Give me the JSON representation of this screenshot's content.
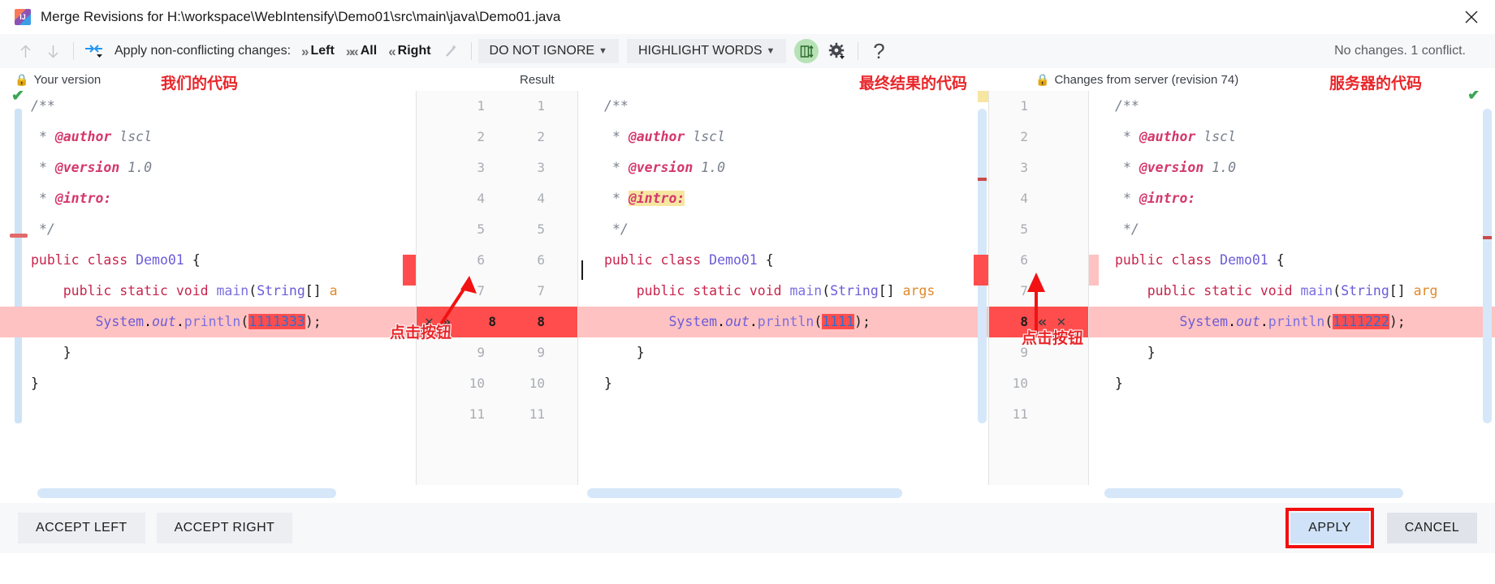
{
  "window": {
    "title": "Merge Revisions for H:\\workspace\\WebIntensify\\Demo01\\src\\main\\java\\Demo01.java",
    "app_icon": "intellij-idea-icon",
    "close_label": "✕"
  },
  "toolbar": {
    "prev_icon": "arrow-up-icon",
    "next_icon": "arrow-down-icon",
    "apply_all_icon": "apply-non-conflicting-icon",
    "apply_label": "Apply non-conflicting changes:",
    "left_label": "Left",
    "all_label": "All",
    "right_label": "Right",
    "magic_icon": "magic-wand-icon",
    "ignore_policy": "DO NOT IGNORE",
    "highlight_policy": "HIGHLIGHT WORDS",
    "collapse_icon": "collapse-unchanged-icon",
    "settings_icon": "gear-icon",
    "help_icon": "help-question-icon",
    "status": "No changes. 1 conflict."
  },
  "panes": {
    "left_title": "Your version",
    "left_annotation": "我们的代码",
    "middle_title": "Result",
    "middle_annotation": "最终结果的代码",
    "right_title": "Changes from server (revision 74)",
    "right_annotation": "服务器的代码",
    "lock_icon": "lock-icon"
  },
  "annotations": {
    "left_button_note": "点击按钮",
    "right_button_note": "点击按钮"
  },
  "left_code": [
    {
      "n": 1,
      "html": "<span class='cmt'>/**</span>"
    },
    {
      "n": 2,
      "html": " <span class='cmt'>* </span><span class='tag'>@author</span><span class='cmt'> lscl</span>"
    },
    {
      "n": 3,
      "html": " <span class='cmt'>* </span><span class='tag'>@version</span><span class='cmt'> 1.0</span>"
    },
    {
      "n": 4,
      "html": " <span class='cmt'>* </span><span class='tag'>@intro:</span>"
    },
    {
      "n": 5,
      "html": " <span class='cmt'>*/</span>"
    },
    {
      "n": 6,
      "html": "<span class='kw'>public class </span><span class='typ'>Demo01</span> <span class='pun'>{</span>"
    },
    {
      "n": 7,
      "html": "    <span class='kw'>public static void </span><span class='idn'>main</span><span class='pun'>(</span><span class='typ'>String</span><span class='pun'>[] </span><span class='var'>a</span>"
    },
    {
      "n": 8,
      "html": "        <span class='typ'>System</span>.<span class='fld'>out</span>.<span class='idn'>println</span><span class='pun'>(</span><span class='hl-red'>1111333</span><span class='pun'>);</span>",
      "conflict": true
    },
    {
      "n": 9,
      "html": "    <span class='pun'>}</span>"
    },
    {
      "n": 10,
      "html": "<span class='pun'>}</span>"
    },
    {
      "n": 11,
      "html": ""
    }
  ],
  "middle_code": [
    {
      "n": 1,
      "html": "<span class='cmt'>/**</span>"
    },
    {
      "n": 2,
      "html": " <span class='cmt'>* </span><span class='tag'>@author</span><span class='cmt'> lscl</span>"
    },
    {
      "n": 3,
      "html": " <span class='cmt'>* </span><span class='tag'>@version</span><span class='cmt'> 1.0</span>"
    },
    {
      "n": 4,
      "html": " <span class='cmt'>* </span><span class='hl-yellow'><span class='tag'>@intro:</span></span>"
    },
    {
      "n": 5,
      "html": " <span class='cmt'>*/</span>"
    },
    {
      "n": 6,
      "html": "<span class='kw'>public class </span><span class='typ'>Demo01</span> <span class='pun'>{</span>"
    },
    {
      "n": 7,
      "html": "    <span class='kw'>public static void </span><span class='idn'>main</span><span class='pun'>(</span><span class='typ'>String</span><span class='pun'>[] </span><span class='var'>args</span>"
    },
    {
      "n": 8,
      "html": "        <span class='typ'>System</span>.<span class='fld'>out</span>.<span class='idn'>println</span><span class='pun'>(</span><span class='hl-red'>1111</span><span class='pun'>);</span>",
      "conflict": true
    },
    {
      "n": 9,
      "html": "    <span class='pun'>}</span>"
    },
    {
      "n": 10,
      "html": "<span class='pun'>}</span>"
    },
    {
      "n": 11,
      "html": ""
    }
  ],
  "right_code": [
    {
      "n": 1,
      "html": "<span class='cmt'>/**</span>"
    },
    {
      "n": 2,
      "html": " <span class='cmt'>* </span><span class='tag'>@author</span><span class='cmt'> lscl</span>"
    },
    {
      "n": 3,
      "html": " <span class='cmt'>* </span><span class='tag'>@version</span><span class='cmt'> 1.0</span>"
    },
    {
      "n": 4,
      "html": " <span class='cmt'>* </span><span class='tag'>@intro:</span>"
    },
    {
      "n": 5,
      "html": " <span class='cmt'>*/</span>"
    },
    {
      "n": 6,
      "html": "<span class='kw'>public class </span><span class='typ'>Demo01</span> <span class='pun'>{</span>"
    },
    {
      "n": 7,
      "html": "    <span class='kw'>public static void </span><span class='idn'>main</span><span class='pun'>(</span><span class='typ'>String</span><span class='pun'>[] </span><span class='var'>arg</span>"
    },
    {
      "n": 8,
      "html": "        <span class='typ'>System</span>.<span class='fld'>out</span>.<span class='idn'>println</span><span class='pun'>(</span><span class='hl-red'>1111222</span><span class='pun'>);</span>",
      "conflict": true
    },
    {
      "n": 9,
      "html": "    <span class='pun'>}</span>"
    },
    {
      "n": 10,
      "html": "<span class='pun'>}</span>"
    },
    {
      "n": 11,
      "html": ""
    }
  ],
  "gutter_left": {
    "numbers_left": [
      "1",
      "2",
      "3",
      "4",
      "5",
      "6",
      "7",
      "8",
      "9",
      "10",
      "11"
    ],
    "numbers_right": [
      "1",
      "2",
      "3",
      "4",
      "5",
      "6",
      "7",
      "8",
      "9",
      "10",
      "11"
    ],
    "conflict_row": 8,
    "accept_icon": "chevron-double-right-icon",
    "reject_icon": "close-x-icon"
  },
  "gutter_right": {
    "numbers": [
      "1",
      "2",
      "3",
      "4",
      "5",
      "6",
      "7",
      "8",
      "9",
      "10",
      "11"
    ],
    "conflict_row": 8,
    "accept_icon": "chevron-double-left-icon",
    "reject_icon": "close-x-icon"
  },
  "bottom": {
    "accept_left": "ACCEPT LEFT",
    "accept_right": "ACCEPT RIGHT",
    "apply": "APPLY",
    "cancel": "CANCEL"
  },
  "colors": {
    "conflict_row": "#ffc2c2",
    "conflict_word": "#ff4d4d",
    "gutter_conflict": "#ff4d4d",
    "annotation_red": "#e8262a",
    "apply_highlight": "#f20f0f",
    "toolbar_bg": "#f7f8fa"
  }
}
